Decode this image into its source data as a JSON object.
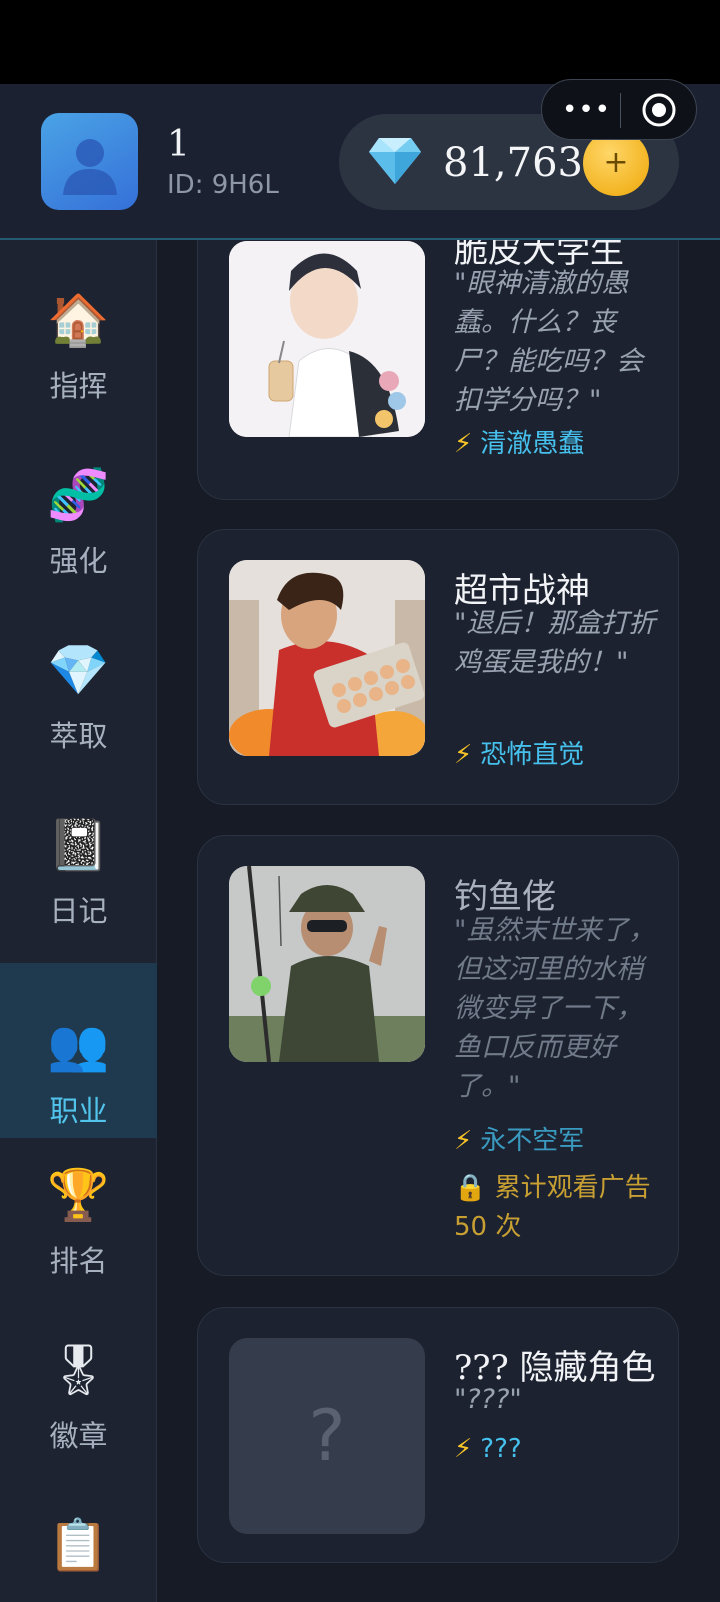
{
  "user": {
    "name": "1",
    "id_label": "ID: 9H6L"
  },
  "currency": {
    "gems": "81,763",
    "add_label": "+",
    "icon": "diamond-icon"
  },
  "mini_program_capsule": {
    "more": "•••",
    "close_icon": "target-icon"
  },
  "sidebar": {
    "items": [
      {
        "emoji": "🏠",
        "label": "指挥",
        "active": false
      },
      {
        "emoji": "🧬",
        "label": "强化",
        "active": false
      },
      {
        "emoji": "💎",
        "label": "萃取",
        "active": false
      },
      {
        "emoji": "📓",
        "label": "日记",
        "active": false
      },
      {
        "emoji": "👥",
        "label": "职业",
        "active": true
      },
      {
        "emoji": "🏆",
        "label": "排名",
        "active": false
      },
      {
        "emoji": "🎖",
        "label": "徽章",
        "active": false
      },
      {
        "emoji": "📋",
        "label": "",
        "active": false
      }
    ]
  },
  "careers": [
    {
      "title": "脆皮大学生",
      "quote": "\"眼神清澈的愚蠢。什么？丧尸？能吃吗？会扣学分吗？\"",
      "skill": "清澈愚蠢",
      "locked": false
    },
    {
      "title": "超市战神",
      "quote": "\"退后！那盒打折鸡蛋是我的！\"",
      "skill": "恐怖直觉",
      "locked": false
    },
    {
      "title": "钓鱼佬",
      "quote": "\"虽然末世来了，但这河里的水稍微变异了一下，鱼口反而更好了。\"",
      "skill": "永不空军",
      "locked": true,
      "unlock": "累计观看广告 50 次"
    },
    {
      "title": "??? 隐藏角色",
      "quote": "\"???\"",
      "skill": "???",
      "locked": false,
      "placeholder": "?"
    }
  ],
  "icons": {
    "lightning": "⚡",
    "lock": "🔒"
  },
  "colors": {
    "accent": "#46c0ec",
    "gold": "#f3b523",
    "lock_text": "#c79f32",
    "background": "#161b25"
  }
}
